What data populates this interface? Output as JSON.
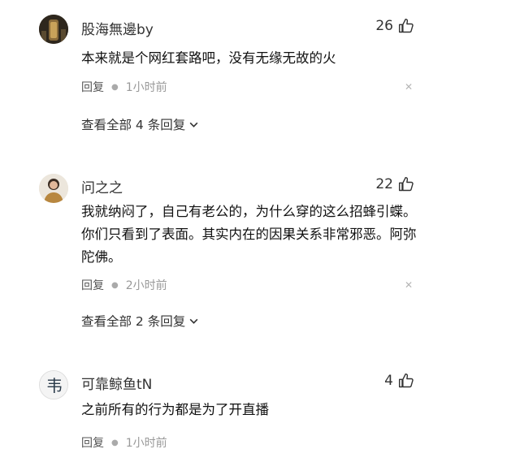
{
  "comments": [
    {
      "username": "股海無邊by",
      "likes": "26",
      "text": "本来就是个网红套路吧，没有无缘无故的火",
      "reply_label": "回复",
      "time": "1小时前",
      "expand_label": "查看全部 4 条回复"
    },
    {
      "username": "问之之",
      "likes": "22",
      "text": "我就纳闷了，自己有老公的，为什么穿的这么招蜂引蝶。你们只看到了表面。其实内在的因果关系非常邪恶。阿弥陀佛。",
      "reply_label": "回复",
      "time": "2小时前",
      "expand_label": "查看全部 2 条回复"
    },
    {
      "username": "可靠鲸鱼tN",
      "likes": "4",
      "text": "之前所有的行为都是为了开直播",
      "reply_label": "回复",
      "time": "1小时前"
    }
  ],
  "avatar3_char": "韦",
  "icons": {
    "like": "thumbs-up-icon",
    "dismiss": "close-icon",
    "expand": "chevron-down-icon"
  }
}
